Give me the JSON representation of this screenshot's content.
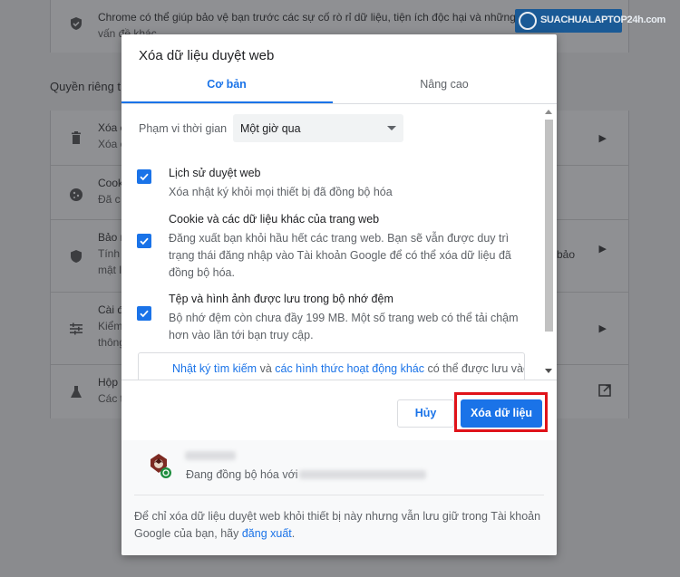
{
  "background": {
    "top_text_line1": "Chrome có thể giúp bảo vệ bạn trước các sự cố rò rỉ dữ liệu, tiện ích độc hại và những",
    "top_text_line2": "vấn đề khác",
    "section_title": "Quyền riêng t",
    "rows": [
      {
        "icon": "trash-icon",
        "t1": "Xóa c",
        "t2": "Xóa c"
      },
      {
        "icon": "cookie-icon",
        "t1": "Cook",
        "t2": "Đã c"
      },
      {
        "icon": "shield-icon",
        "t1": "Bảo m",
        "t2": "Tính",
        "t3": "mật l"
      },
      {
        "icon": "tune-icon",
        "t1": "Cài đ",
        "t2": "Kiểm",
        "t3": "thông"
      },
      {
        "icon": "flask-icon",
        "t1": "Hộp",
        "t2": "Các t"
      }
    ],
    "right_fragment": "bảo",
    "logo_text": "SUACHUALAPTOP24h.com"
  },
  "dialog": {
    "title": "Xóa dữ liệu duyệt web",
    "tabs": [
      {
        "label": "Cơ bản",
        "active": true
      },
      {
        "label": "Nâng cao",
        "active": false
      }
    ],
    "time_range": {
      "label": "Phạm vi thời gian",
      "value": "Một giờ qua"
    },
    "options": [
      {
        "title": "Lịch sử duyệt web",
        "desc": "Xóa nhật ký khỏi mọi thiết bị đã đồng bộ hóa",
        "checked": true
      },
      {
        "title": "Cookie và các dữ liệu khác của trang web",
        "desc": "Đăng xuất bạn khỏi hầu hết các trang web. Bạn sẽ vẫn được duy trì trạng thái đăng nhập vào Tài khoản Google để có thể xóa dữ liệu đã đồng bộ hóa.",
        "checked": true
      },
      {
        "title": "Tệp và hình ảnh được lưu trong bộ nhớ đệm",
        "desc": "Bộ nhớ đệm còn chưa đầy 199 MB. Một số trang web có thể tải chậm hơn vào lần tới bạn truy cập.",
        "checked": true
      }
    ],
    "info": {
      "link1": "Nhật ký tìm kiếm",
      "mid": "và",
      "link2": "các hình thức hoạt động khác",
      "rest": "có thể được lưu vào"
    },
    "cancel_label": "Hủy",
    "clear_label": "Xóa dữ liệu",
    "account": {
      "sync_label": "Đang đồng bộ hóa với"
    },
    "note_text": "Để chỉ xóa dữ liệu duyệt web khỏi thiết bị này nhưng vẫn lưu giữ trong Tài khoản Google của bạn, hãy",
    "note_link": "đăng xuất",
    "note_end": "."
  },
  "colors": {
    "accent": "#1a73e8",
    "highlight": "#e0131a"
  }
}
